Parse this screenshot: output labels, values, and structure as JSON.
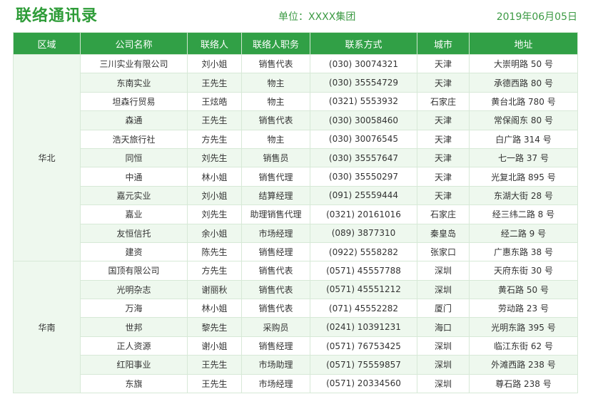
{
  "title": "联络通讯录",
  "unit": "单位：XXXX集团",
  "date": "2019年06月05日",
  "headers": [
    "区域",
    "公司名称",
    "联络人",
    "联络人职务",
    "联系方式",
    "城市",
    "地址"
  ],
  "groups": [
    {
      "region": "华北",
      "rows": [
        [
          "三川实业有限公司",
          "刘小姐",
          "销售代表",
          "(030) 30074321",
          "天津",
          "大崇明路 50 号"
        ],
        [
          "东南实业",
          "王先生",
          "物主",
          "(030) 35554729",
          "天津",
          "承德西路 80 号"
        ],
        [
          "坦森行贸易",
          "王炫皓",
          "物主",
          "(0321) 5553932",
          "石家庄",
          "黄台北路 780 号"
        ],
        [
          "森通",
          "王先生",
          "销售代表",
          "(030) 30058460",
          "天津",
          "常保阁东 80 号"
        ],
        [
          "浩天旅行社",
          "方先生",
          "物主",
          "(030) 30076545",
          "天津",
          "白广路 314 号"
        ],
        [
          "同恒",
          "刘先生",
          "销售员",
          "(030) 35557647",
          "天津",
          "七一路 37 号"
        ],
        [
          "中通",
          "林小姐",
          "销售代理",
          "(030) 35550297",
          "天津",
          "光复北路 895 号"
        ],
        [
          "嘉元实业",
          "刘小姐",
          "结算经理",
          "(091) 25559444",
          "天津",
          "东湖大街 28 号"
        ],
        [
          "嘉业",
          "刘先生",
          "助理销售代理",
          "(0321) 20161016",
          "石家庄",
          "经三纬二路 8 号"
        ],
        [
          "友恒信托",
          "余小姐",
          "市场经理",
          "(089) 3877310",
          "秦皇岛",
          "经二路 9 号"
        ],
        [
          "建资",
          "陈先生",
          "销售经理",
          "(0922) 5558282",
          "张家口",
          "广惠东路 38 号"
        ]
      ]
    },
    {
      "region": "华南",
      "rows": [
        [
          "国顶有限公司",
          "方先生",
          "销售代表",
          "(0571) 45557788",
          "深圳",
          "天府东街 30 号"
        ],
        [
          "光明杂志",
          "谢丽秋",
          "销售代表",
          "(0571) 45551212",
          "深圳",
          "黄石路 50 号"
        ],
        [
          "万海",
          "林小姐",
          "销售代表",
          "(071) 45552282",
          "厦门",
          "劳动路 23 号"
        ],
        [
          "世邦",
          "黎先生",
          "采购员",
          "(0241) 10391231",
          "海口",
          "光明东路 395 号"
        ],
        [
          "正人资源",
          "谢小姐",
          "销售经理",
          "(0571) 76753425",
          "深圳",
          "临江东街 62 号"
        ],
        [
          "红阳事业",
          "王先生",
          "市场助理",
          "(0571) 75559857",
          "深圳",
          "外滩西路 238 号"
        ],
        [
          "东旗",
          "王先生",
          "市场经理",
          "(0571) 20334560",
          "深圳",
          "尊石路 238 号"
        ]
      ]
    }
  ]
}
